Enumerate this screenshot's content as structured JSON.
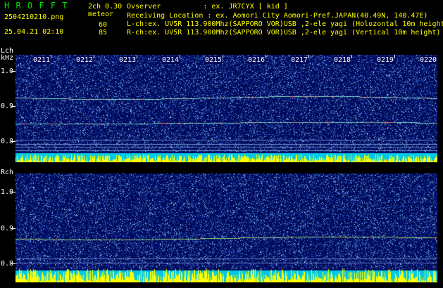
{
  "header": {
    "app_name": "H R O F F T",
    "mode": "2ch 0.30",
    "meteor_label": "meteor",
    "filename": "2504210210.png",
    "datetime": "25.04.21 02:10",
    "meteor_count_l": "60",
    "meteor_count_r": "85",
    "observer_line": "Ovserver          : ex. JR7CYX [ kid ]",
    "location_line": "Receiving Location : ex. Aomori City Aomori-Pref.JAPAN(40.49N, 140.47E)",
    "lch_line": "L-ch:ex. UV5R 113.900Mhz(SAPPORO VOR)USB ,2-ele yagi (Holozontal 10m height)",
    "rch_line": "R-ch:ex. UV5R 113.900Mhz(SAPPORO VOR)USB ,2-ele yagi (Vertical 10m height)"
  },
  "lch": {
    "label": "Lch",
    "unit": "kHz",
    "y_ticks": [
      "1.0",
      "0.9",
      "0.8"
    ]
  },
  "rch": {
    "label": "Rch",
    "y_ticks": [
      "1.0",
      "0.9",
      "0.8"
    ]
  },
  "time_ticks": [
    "0211",
    "0212",
    "0213",
    "0214",
    "0215",
    "0216",
    "0217",
    "0218",
    "0219",
    "0220"
  ],
  "colors": {
    "background": "#000000",
    "panel": "#000a5a",
    "title_green": "#00e000",
    "text_yellow": "#ffff00",
    "trace": "#7fe6e0",
    "activity_bars": "#ffff00",
    "baseline": "#00c8e6"
  }
}
